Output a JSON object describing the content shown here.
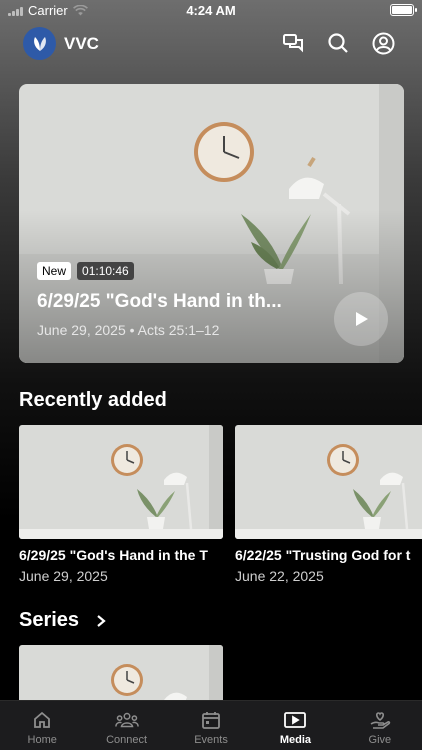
{
  "status_bar": {
    "carrier": "Carrier",
    "time": "4:24 AM"
  },
  "header": {
    "brand": "VVC",
    "icons": [
      "chat-bubbles-icon",
      "search-icon",
      "account-icon"
    ]
  },
  "hero": {
    "badge_new": "New",
    "duration": "01:10:46",
    "title": "6/29/25 \"God's Hand in th...",
    "meta": "June 29, 2025 • Acts 25:1–12"
  },
  "recently_added": {
    "title": "Recently added",
    "items": [
      {
        "title": "6/29/25 \"God's Hand in the T",
        "date": "June 29, 2025"
      },
      {
        "title": "6/22/25 \"Trusting God for t",
        "date": "June 22, 2025"
      }
    ]
  },
  "series": {
    "title": "Series"
  },
  "tabbar": {
    "active": "Media",
    "items": [
      {
        "label": "Home",
        "icon": "home-icon"
      },
      {
        "label": "Connect",
        "icon": "people-icon"
      },
      {
        "label": "Events",
        "icon": "calendar-icon"
      },
      {
        "label": "Media",
        "icon": "play-screen-icon"
      },
      {
        "label": "Give",
        "icon": "heart-hand-icon"
      }
    ]
  },
  "colors": {
    "logo_blue": "#2e5aa8",
    "tab_bg": "#1c1c1e",
    "inactive": "#8e8e8e"
  }
}
